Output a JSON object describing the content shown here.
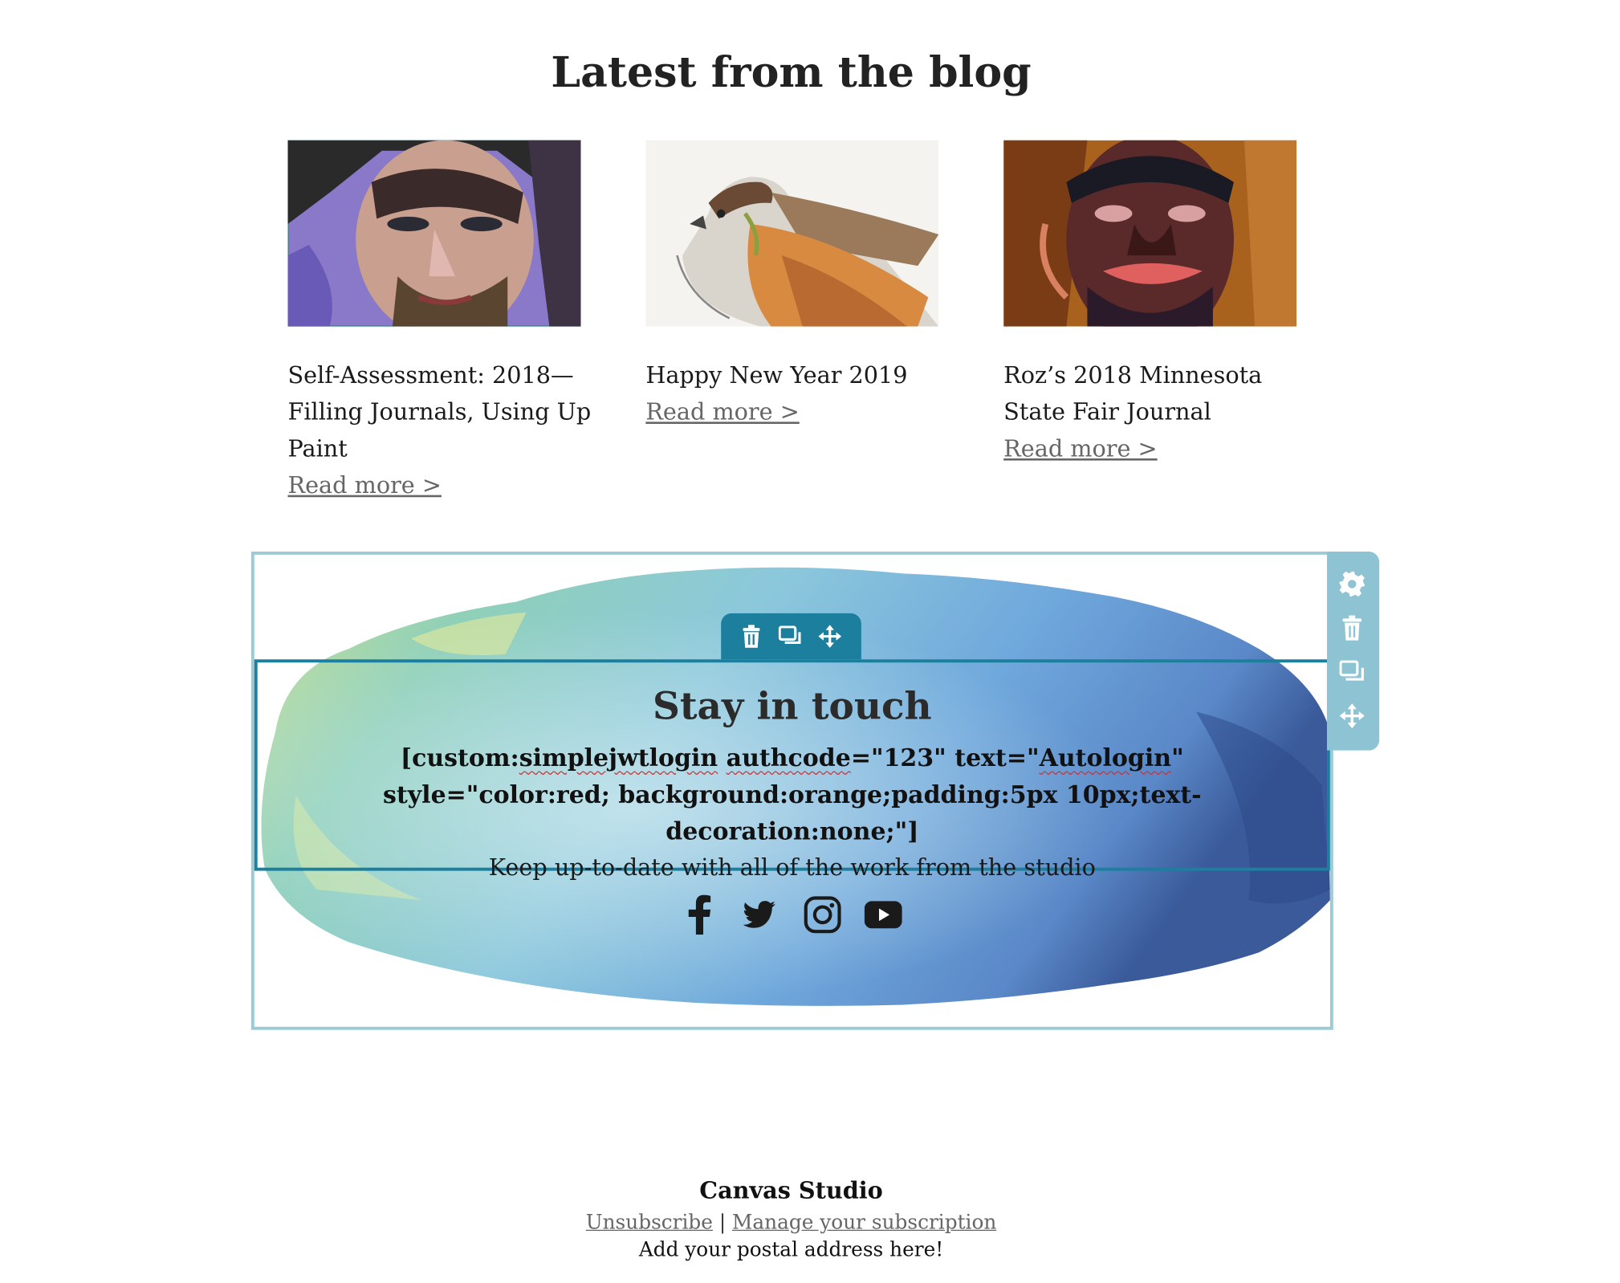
{
  "blog": {
    "heading": "Latest from the blog",
    "posts": [
      {
        "title": "Self-Assessment: 2018—Filling Journals, Using Up Paint",
        "read_more": "Read more >"
      },
      {
        "title": "Happy New Year 2019",
        "read_more": "Read more >"
      },
      {
        "title": "Roz’s 2018 Minnesota State Fair Journal",
        "read_more": "Read more >"
      }
    ]
  },
  "newsletter": {
    "title": "Stay in touch",
    "shortcode_parts": {
      "p1": "[custom:",
      "p2": "simplejwtlogin",
      "p3": " ",
      "p4": "authcode",
      "p5": "=\"123\" text=\"",
      "p6": "Autologin",
      "p7": "\" style=\"color:red; background:orange;padding:5px 10px;text-decoration:none;\"]"
    },
    "tagline": "Keep up-to-date with all of the work from the studio",
    "social": [
      "facebook-icon",
      "twitter-icon",
      "instagram-icon",
      "youtube-icon"
    ]
  },
  "editor": {
    "side_toolbar": [
      "gear-icon",
      "trash-icon",
      "duplicate-icon",
      "move-icon"
    ],
    "inner_toolbar": [
      "trash-icon",
      "duplicate-icon",
      "move-icon"
    ],
    "colors": {
      "block_border": "#9ccbd6",
      "text_block_border": "#1d7f9e",
      "side_toolbar": "#8dc3d3"
    }
  },
  "footer": {
    "brand": "Canvas Studio",
    "unsubscribe": "Unsubscribe",
    "separator": "|",
    "manage": "Manage your subscription",
    "address": "Add your postal address here!"
  }
}
